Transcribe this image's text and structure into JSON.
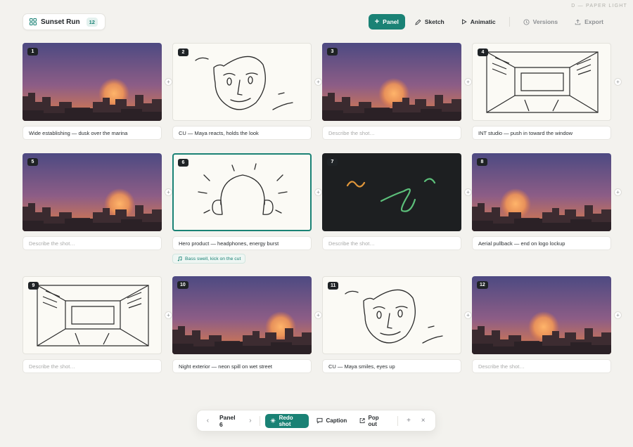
{
  "corner_label": "D — PAPER LIGHT",
  "project": {
    "title": "Sunset Run",
    "panel_count": "12"
  },
  "toolbar": {
    "panel": "Panel",
    "sketch": "Sketch",
    "animatic": "Animatic",
    "versions": "Versions",
    "export": "Export"
  },
  "panels": [
    {
      "number": "1",
      "art": "sunset",
      "caption": "Wide establishing — dusk over the marina"
    },
    {
      "number": "2",
      "art": "face",
      "caption": "CU — Maya reacts, holds the look"
    },
    {
      "number": "3",
      "art": "sunset",
      "caption": ""
    },
    {
      "number": "4",
      "art": "room",
      "caption": "INT studio — push in toward the window"
    },
    {
      "number": "5",
      "art": "sunset",
      "caption": ""
    },
    {
      "number": "6",
      "art": "headphones",
      "caption": "Hero product — headphones, energy burst",
      "selected": true,
      "sound_note": "Bass swell, kick on the cut"
    },
    {
      "number": "7",
      "art": "scribble",
      "caption": ""
    },
    {
      "number": "8",
      "art": "sunset",
      "caption": "Aerial pullback — end on logo lockup"
    },
    {
      "number": "9",
      "art": "room",
      "caption": ""
    },
    {
      "number": "10",
      "art": "sunset",
      "caption": "Night exterior — neon spill on wet street"
    },
    {
      "number": "11",
      "art": "face",
      "caption": "CU — Maya smiles, eyes up"
    },
    {
      "number": "12",
      "art": "sunset",
      "caption": ""
    }
  ],
  "caption_placeholder": "Describe the shot…",
  "bottom_bar": {
    "title": "Panel 6",
    "redo": "Redo shot",
    "caption": "Caption",
    "pop_out": "Pop out"
  },
  "colors": {
    "accent": "#1a8275",
    "sky_top": "#4d4a82",
    "sky_bottom": "#e07e45",
    "sun": "#ffb56a"
  }
}
